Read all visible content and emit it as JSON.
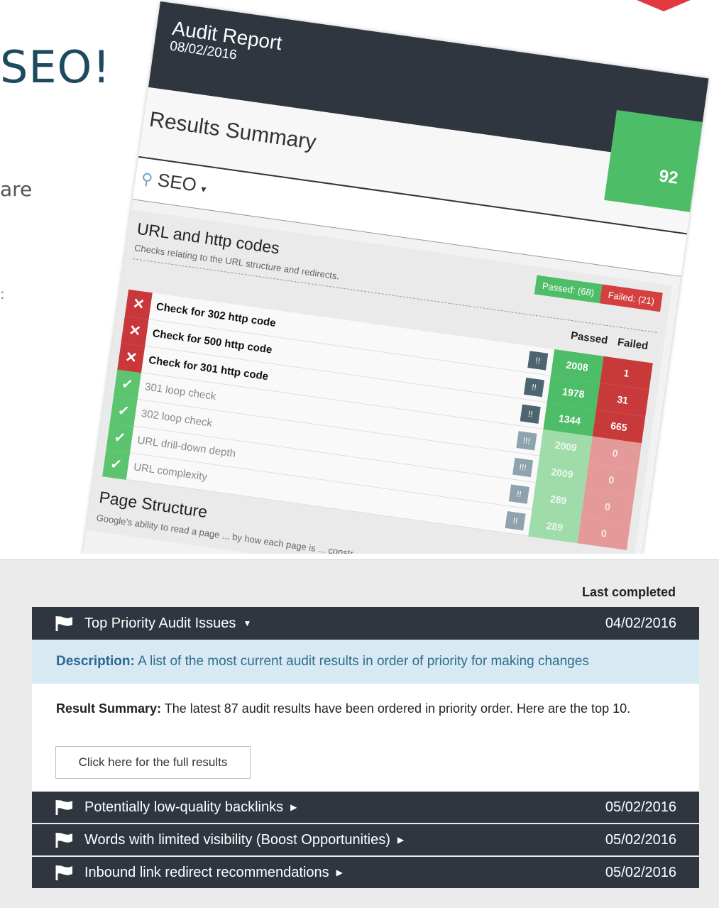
{
  "background": {
    "heading": "SEO!",
    "fragment_1": "are",
    "fragment_2": ":"
  },
  "report": {
    "title": "Audit Report",
    "date": "08/02/2016",
    "summary_title": "Results Summary",
    "score": "92",
    "category": "SEO",
    "section": {
      "title": "URL and http codes",
      "description": "Checks relating to the URL structure and redirects.",
      "passed_badge": "Passed: (68)",
      "failed_badge": "Failed: (21)",
      "col_passed": "Passed",
      "col_failed": "Failed",
      "checks": [
        {
          "name": "Check for 302 http code",
          "status": "fail",
          "passed": "2008",
          "failed": "1"
        },
        {
          "name": "Check for 500 http code",
          "status": "fail",
          "passed": "1978",
          "failed": "31"
        },
        {
          "name": "Check for 301 http code",
          "status": "fail",
          "passed": "1344",
          "failed": "665"
        },
        {
          "name": "301 loop check",
          "status": "pass",
          "passed": "2009",
          "failed": "0"
        },
        {
          "name": "302 loop check",
          "status": "pass",
          "passed": "2009",
          "failed": "0"
        },
        {
          "name": "URL drill-down depth",
          "status": "pass",
          "passed": "289",
          "failed": "0"
        },
        {
          "name": "URL complexity",
          "status": "pass",
          "passed": "289",
          "failed": "0"
        }
      ]
    },
    "section2": {
      "title": "Page Structure",
      "description": "Google's ability to read a page ... by how each page is ... constr..."
    }
  },
  "panel": {
    "last_completed_label": "Last completed",
    "top": {
      "label": "Top Priority Audit Issues",
      "date": "04/02/2016"
    },
    "description_label": "Description:",
    "description_text": " A list of the most current audit results in order of priority for making changes",
    "result_label": "Result Summary:",
    "result_text": " The latest 87 audit results have been ordered in priority order. Here are the top 10.",
    "full_results_button": "Click here for the full results",
    "items": [
      {
        "label": "Potentially low-quality backlinks",
        "date": "05/02/2016"
      },
      {
        "label": "Words with limited visibility (Boost Opportunities)",
        "date": "05/02/2016"
      },
      {
        "label": "Inbound link redirect recommendations",
        "date": "05/02/2016"
      }
    ],
    "icons": {
      "flag": "flag-icon",
      "caret_down": "caret-down-icon",
      "caret_right": "caret-right-icon"
    }
  }
}
